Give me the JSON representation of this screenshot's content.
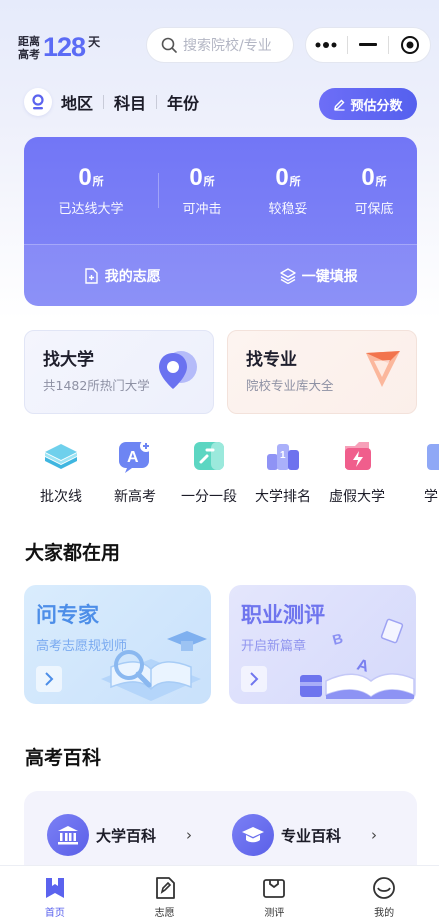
{
  "countdown": {
    "label_line1": "距离",
    "label_line2": "高考",
    "days": "128",
    "unit": "天"
  },
  "search": {
    "placeholder": "搜索院校/专业"
  },
  "capsule": {
    "more_icon": "more-dots-icon",
    "minimize_icon": "minus-icon",
    "close_icon": "target-circle-icon"
  },
  "filter": {
    "items": [
      "地区",
      "科目",
      "年份"
    ],
    "estimate_label": "预估分数"
  },
  "stats": {
    "main": {
      "value": "0",
      "unit": "所",
      "label": "已达线大学"
    },
    "items": [
      {
        "value": "0",
        "unit": "所",
        "label": "可冲击"
      },
      {
        "value": "0",
        "unit": "所",
        "label": "较稳妥"
      },
      {
        "value": "0",
        "unit": "所",
        "label": "可保底"
      }
    ],
    "my_wishes": "我的志愿",
    "one_click_fill": "一键填报"
  },
  "find": {
    "university": {
      "title": "找大学",
      "subtitle": "共1482所热门大学"
    },
    "major": {
      "title": "找专业",
      "subtitle": "院校专业库大全"
    }
  },
  "quick_links": [
    "批次线",
    "新高考",
    "一分一段",
    "大学排名",
    "虚假大学",
    "学"
  ],
  "sections": {
    "popular": "大家都在用",
    "encyclopedia": "高考百科"
  },
  "promos": {
    "ask_expert": {
      "title": "问专家",
      "subtitle": "高考志愿规划师"
    },
    "career_test": {
      "title": "职业测评",
      "subtitle": "开启新篇章"
    }
  },
  "encyclopedia": {
    "university": "大学百科",
    "major": "专业百科",
    "chevron": "›"
  },
  "tabs": [
    {
      "label": "首页",
      "active": true
    },
    {
      "label": "志愿",
      "active": false
    },
    {
      "label": "测评",
      "active": false
    },
    {
      "label": "我的",
      "active": false
    }
  ],
  "colors": {
    "accent": "#5b63ee",
    "stats_card": "#7276f6"
  }
}
